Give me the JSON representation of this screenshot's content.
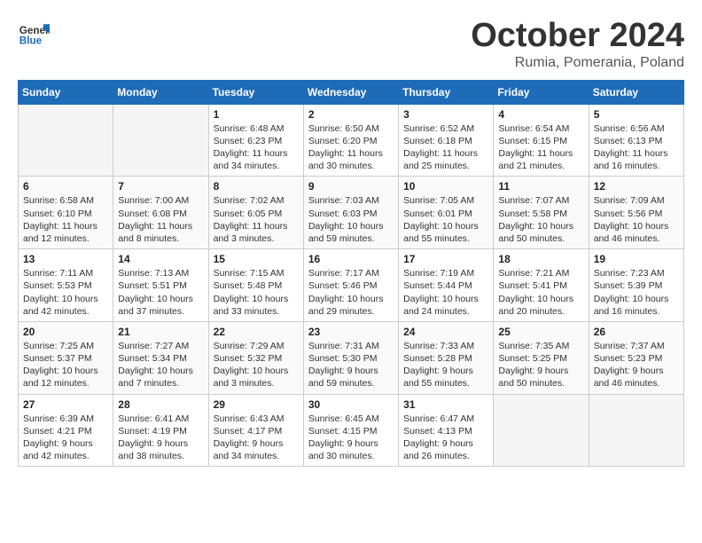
{
  "header": {
    "logo_text_general": "General",
    "logo_text_blue": "Blue",
    "month": "October 2024",
    "location": "Rumia, Pomerania, Poland"
  },
  "weekdays": [
    "Sunday",
    "Monday",
    "Tuesday",
    "Wednesday",
    "Thursday",
    "Friday",
    "Saturday"
  ],
  "weeks": [
    [
      {
        "day": "",
        "info": ""
      },
      {
        "day": "",
        "info": ""
      },
      {
        "day": "1",
        "info": "Sunrise: 6:48 AM\nSunset: 6:23 PM\nDaylight: 11 hours and 34 minutes."
      },
      {
        "day": "2",
        "info": "Sunrise: 6:50 AM\nSunset: 6:20 PM\nDaylight: 11 hours and 30 minutes."
      },
      {
        "day": "3",
        "info": "Sunrise: 6:52 AM\nSunset: 6:18 PM\nDaylight: 11 hours and 25 minutes."
      },
      {
        "day": "4",
        "info": "Sunrise: 6:54 AM\nSunset: 6:15 PM\nDaylight: 11 hours and 21 minutes."
      },
      {
        "day": "5",
        "info": "Sunrise: 6:56 AM\nSunset: 6:13 PM\nDaylight: 11 hours and 16 minutes."
      }
    ],
    [
      {
        "day": "6",
        "info": "Sunrise: 6:58 AM\nSunset: 6:10 PM\nDaylight: 11 hours and 12 minutes."
      },
      {
        "day": "7",
        "info": "Sunrise: 7:00 AM\nSunset: 6:08 PM\nDaylight: 11 hours and 8 minutes."
      },
      {
        "day": "8",
        "info": "Sunrise: 7:02 AM\nSunset: 6:05 PM\nDaylight: 11 hours and 3 minutes."
      },
      {
        "day": "9",
        "info": "Sunrise: 7:03 AM\nSunset: 6:03 PM\nDaylight: 10 hours and 59 minutes."
      },
      {
        "day": "10",
        "info": "Sunrise: 7:05 AM\nSunset: 6:01 PM\nDaylight: 10 hours and 55 minutes."
      },
      {
        "day": "11",
        "info": "Sunrise: 7:07 AM\nSunset: 5:58 PM\nDaylight: 10 hours and 50 minutes."
      },
      {
        "day": "12",
        "info": "Sunrise: 7:09 AM\nSunset: 5:56 PM\nDaylight: 10 hours and 46 minutes."
      }
    ],
    [
      {
        "day": "13",
        "info": "Sunrise: 7:11 AM\nSunset: 5:53 PM\nDaylight: 10 hours and 42 minutes."
      },
      {
        "day": "14",
        "info": "Sunrise: 7:13 AM\nSunset: 5:51 PM\nDaylight: 10 hours and 37 minutes."
      },
      {
        "day": "15",
        "info": "Sunrise: 7:15 AM\nSunset: 5:48 PM\nDaylight: 10 hours and 33 minutes."
      },
      {
        "day": "16",
        "info": "Sunrise: 7:17 AM\nSunset: 5:46 PM\nDaylight: 10 hours and 29 minutes."
      },
      {
        "day": "17",
        "info": "Sunrise: 7:19 AM\nSunset: 5:44 PM\nDaylight: 10 hours and 24 minutes."
      },
      {
        "day": "18",
        "info": "Sunrise: 7:21 AM\nSunset: 5:41 PM\nDaylight: 10 hours and 20 minutes."
      },
      {
        "day": "19",
        "info": "Sunrise: 7:23 AM\nSunset: 5:39 PM\nDaylight: 10 hours and 16 minutes."
      }
    ],
    [
      {
        "day": "20",
        "info": "Sunrise: 7:25 AM\nSunset: 5:37 PM\nDaylight: 10 hours and 12 minutes."
      },
      {
        "day": "21",
        "info": "Sunrise: 7:27 AM\nSunset: 5:34 PM\nDaylight: 10 hours and 7 minutes."
      },
      {
        "day": "22",
        "info": "Sunrise: 7:29 AM\nSunset: 5:32 PM\nDaylight: 10 hours and 3 minutes."
      },
      {
        "day": "23",
        "info": "Sunrise: 7:31 AM\nSunset: 5:30 PM\nDaylight: 9 hours and 59 minutes."
      },
      {
        "day": "24",
        "info": "Sunrise: 7:33 AM\nSunset: 5:28 PM\nDaylight: 9 hours and 55 minutes."
      },
      {
        "day": "25",
        "info": "Sunrise: 7:35 AM\nSunset: 5:25 PM\nDaylight: 9 hours and 50 minutes."
      },
      {
        "day": "26",
        "info": "Sunrise: 7:37 AM\nSunset: 5:23 PM\nDaylight: 9 hours and 46 minutes."
      }
    ],
    [
      {
        "day": "27",
        "info": "Sunrise: 6:39 AM\nSunset: 4:21 PM\nDaylight: 9 hours and 42 minutes."
      },
      {
        "day": "28",
        "info": "Sunrise: 6:41 AM\nSunset: 4:19 PM\nDaylight: 9 hours and 38 minutes."
      },
      {
        "day": "29",
        "info": "Sunrise: 6:43 AM\nSunset: 4:17 PM\nDaylight: 9 hours and 34 minutes."
      },
      {
        "day": "30",
        "info": "Sunrise: 6:45 AM\nSunset: 4:15 PM\nDaylight: 9 hours and 30 minutes."
      },
      {
        "day": "31",
        "info": "Sunrise: 6:47 AM\nSunset: 4:13 PM\nDaylight: 9 hours and 26 minutes."
      },
      {
        "day": "",
        "info": ""
      },
      {
        "day": "",
        "info": ""
      }
    ]
  ]
}
